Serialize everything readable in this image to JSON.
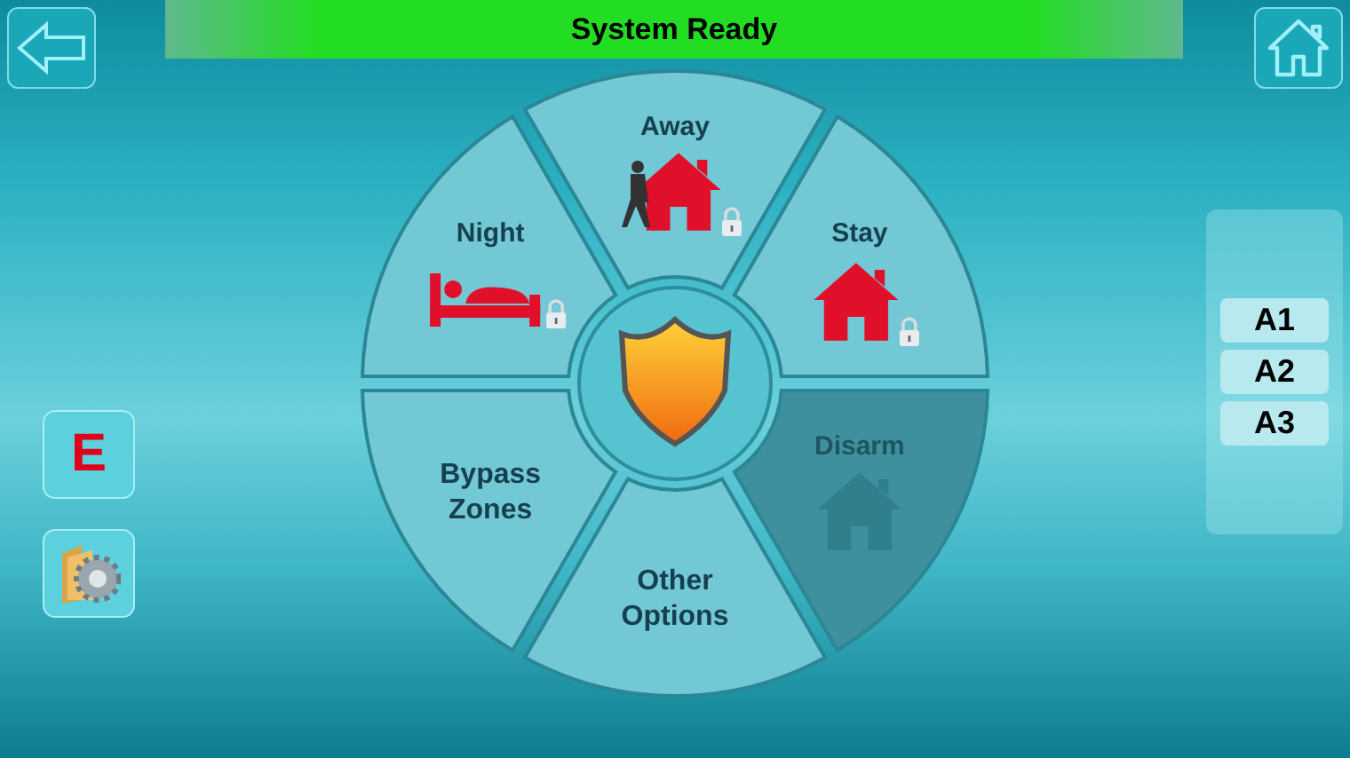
{
  "status_bar": {
    "text": "System Ready"
  },
  "segments": [
    {
      "label": "Night",
      "kind": "night",
      "locked": true,
      "disabled": false
    },
    {
      "label": "Away",
      "kind": "away",
      "locked": true,
      "disabled": false
    },
    {
      "label": "Stay",
      "kind": "stay",
      "locked": true,
      "disabled": false
    },
    {
      "label": "Disarm",
      "kind": "disarm",
      "locked": false,
      "disabled": true
    },
    {
      "label": "Other Options",
      "kind": "text"
    },
    {
      "label": "Bypass Zones",
      "kind": "text"
    }
  ],
  "side_buttons": [
    {
      "kind": "letter",
      "text": "E"
    },
    {
      "kind": "folder"
    }
  ],
  "areas": [
    {
      "label": "A1"
    },
    {
      "label": "A2"
    },
    {
      "label": "A3"
    }
  ]
}
